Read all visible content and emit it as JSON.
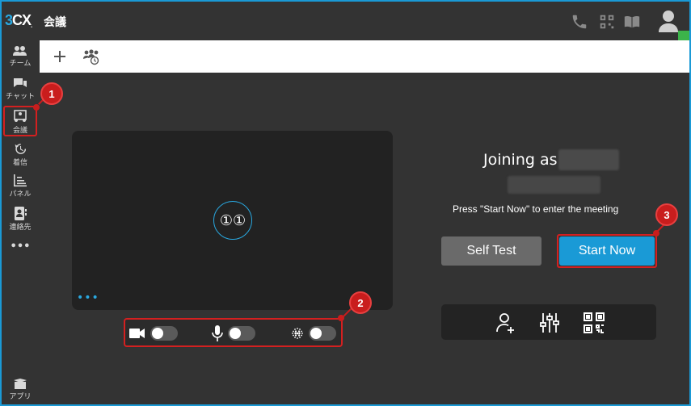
{
  "header": {
    "logo_prefix": "3",
    "logo_main": "CX",
    "logo_dot": ".",
    "title": "会議"
  },
  "sidebar": {
    "items": [
      {
        "label": "チーム",
        "icon": "team-icon"
      },
      {
        "label": "チャット",
        "icon": "chat-icon"
      },
      {
        "label": "会議",
        "icon": "meeting-icon"
      },
      {
        "label": "着信",
        "icon": "history-icon"
      },
      {
        "label": "パネル",
        "icon": "panel-icon"
      },
      {
        "label": "連絡先",
        "icon": "contacts-icon"
      },
      {
        "label": "•••",
        "icon": "more-icon"
      }
    ],
    "apps_label": "アプリ"
  },
  "video": {
    "avatar_text": "①①",
    "dots": "•••"
  },
  "join": {
    "joining_label": "Joining as",
    "instruction": "Press \"Start Now\" to enter the meeting",
    "self_test_label": "Self Test",
    "start_now_label": "Start Now"
  },
  "badges": {
    "b1": "1",
    "b2": "2",
    "b3": "3"
  },
  "colors": {
    "accent": "#1a9ad6",
    "background": "#333333",
    "highlight": "#d42020",
    "presence": "#3cb34a"
  }
}
